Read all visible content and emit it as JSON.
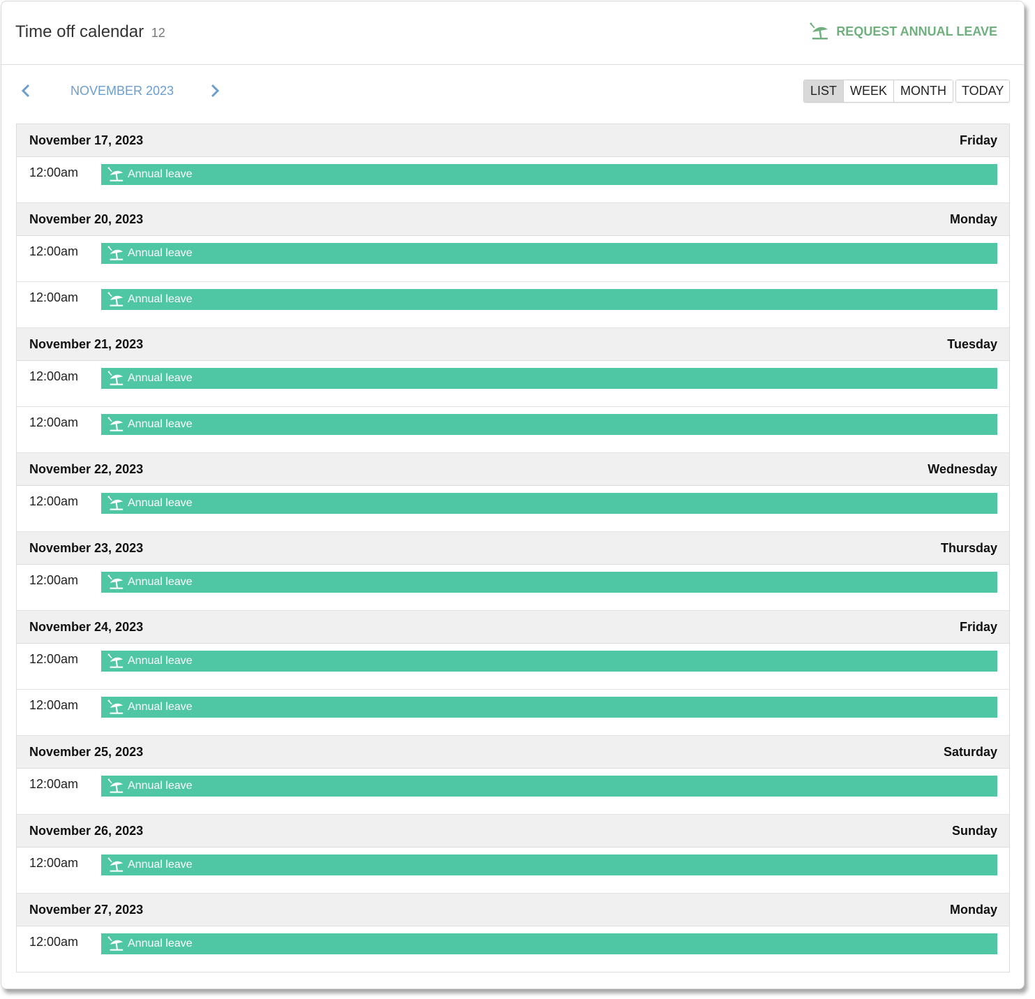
{
  "header": {
    "title": "Time off calendar",
    "count": "12",
    "request_label": "REQUEST ANNUAL LEAVE"
  },
  "toolbar": {
    "month_label": "NOVEMBER 2023",
    "views": [
      "LIST",
      "WEEK",
      "MONTH"
    ],
    "active_view": "LIST",
    "today_label": "TODAY"
  },
  "colors": {
    "event_bar": "#4fc6a4",
    "accent_green": "#6fb07e",
    "month_blue": "#6a9ecf"
  },
  "days": [
    {
      "date": "November 17, 2023",
      "weekday": "Friday",
      "events": [
        {
          "time": "12:00am",
          "label": "Annual leave"
        }
      ]
    },
    {
      "date": "November 20, 2023",
      "weekday": "Monday",
      "events": [
        {
          "time": "12:00am",
          "label": "Annual leave"
        },
        {
          "time": "12:00am",
          "label": "Annual leave"
        }
      ]
    },
    {
      "date": "November 21, 2023",
      "weekday": "Tuesday",
      "events": [
        {
          "time": "12:00am",
          "label": "Annual leave"
        },
        {
          "time": "12:00am",
          "label": "Annual leave"
        }
      ]
    },
    {
      "date": "November 22, 2023",
      "weekday": "Wednesday",
      "events": [
        {
          "time": "12:00am",
          "label": "Annual leave"
        }
      ]
    },
    {
      "date": "November 23, 2023",
      "weekday": "Thursday",
      "events": [
        {
          "time": "12:00am",
          "label": "Annual leave"
        }
      ]
    },
    {
      "date": "November 24, 2023",
      "weekday": "Friday",
      "events": [
        {
          "time": "12:00am",
          "label": "Annual leave"
        },
        {
          "time": "12:00am",
          "label": "Annual leave"
        }
      ]
    },
    {
      "date": "November 25, 2023",
      "weekday": "Saturday",
      "events": [
        {
          "time": "12:00am",
          "label": "Annual leave"
        }
      ]
    },
    {
      "date": "November 26, 2023",
      "weekday": "Sunday",
      "events": [
        {
          "time": "12:00am",
          "label": "Annual leave"
        }
      ]
    },
    {
      "date": "November 27, 2023",
      "weekday": "Monday",
      "events": [
        {
          "time": "12:00am",
          "label": "Annual leave"
        }
      ]
    }
  ]
}
